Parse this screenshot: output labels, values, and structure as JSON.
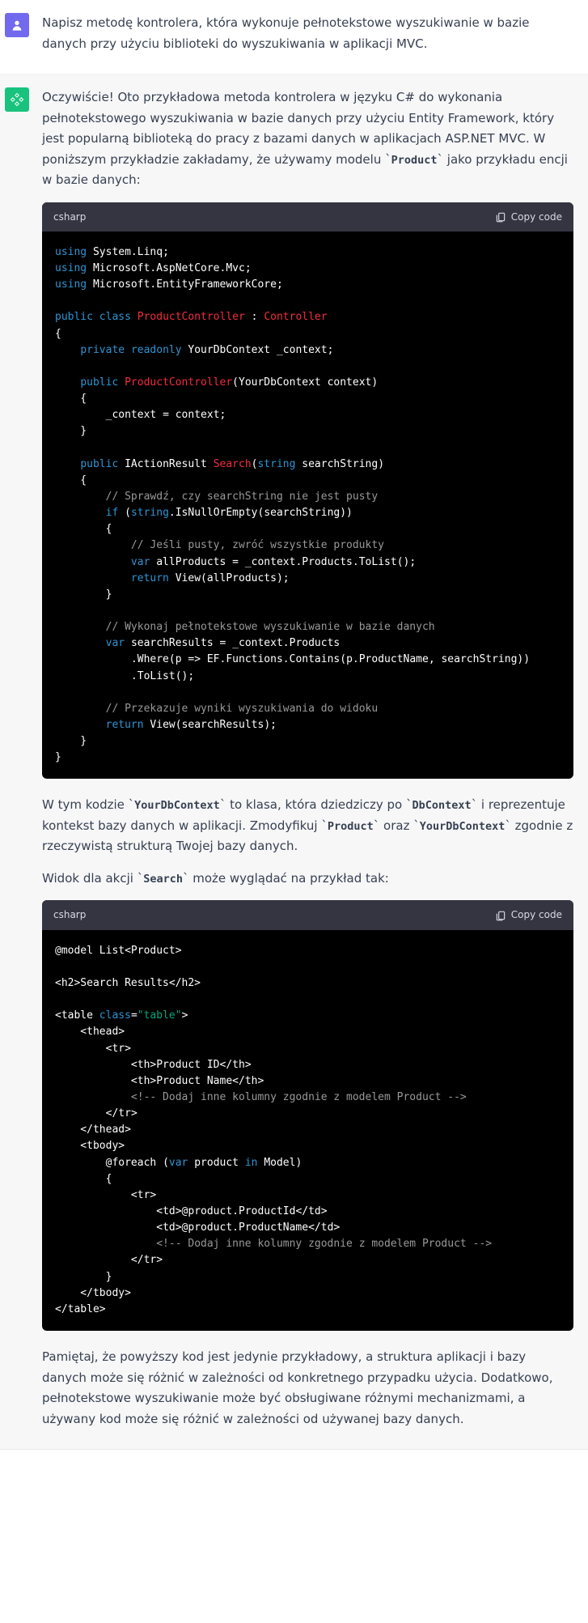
{
  "user": {
    "message": "Napisz metodę kontrolera, która wykonuje pełnotekstowe wyszukiwanie w bazie danych przy użyciu biblioteki do wyszukiwania w aplikacji MVC."
  },
  "assistant": {
    "intro_0": "Oczywiście! Oto przykładowa metoda kontrolera w języku C# do wykonania pełnotekstowego wyszukiwania w bazie danych przy użyciu Entity Framework, który jest popularną biblioteką do pracy z bazami danych w aplikacjach ASP.NET MVC. W poniższym przykładzie zakładamy, że używamy modelu ",
    "intro_code_product": "Product",
    "intro_1": " jako przykładu encji w bazie danych:",
    "code1": {
      "lang": "csharp",
      "copy": "Copy code",
      "tokens": {
        "using": "using",
        "ns1": "System.Linq",
        "ns2": "Microsoft.AspNetCore.Mvc",
        "ns3": "Microsoft.EntityFrameworkCore",
        "public": "public",
        "class": "class",
        "private": "private",
        "readonly": "readonly",
        "return": "return",
        "var": "var",
        "if": "if",
        "string": "string",
        "ProductController": "ProductController",
        "Controller": "Controller",
        "YourDbContext": "YourDbContext",
        "_context": "_context",
        "context": "context",
        "IActionResult": "IActionResult",
        "Search": "Search",
        "searchString": "searchString",
        "IsNullOrEmpty": "IsNullOrEmpty",
        "allProducts": "allProducts",
        "Products": "Products",
        "ToList": "ToList",
        "View": "View",
        "searchResults": "searchResults",
        "Where": "Where",
        "EF": "EF",
        "Functions": "Functions",
        "Contains": "Contains",
        "ProductName": "ProductName",
        "c_check": "// Sprawdź, czy searchString nie jest pusty",
        "c_empty": "// Jeśli pusty, zwróć wszystkie produkty",
        "c_full": "// Wykonaj pełnotekstowe wyszukiwanie w bazie danych",
        "c_pass": "// Przekazuje wyniki wyszukiwania do widoku"
      }
    },
    "mid_0": "W tym kodzie ",
    "mid_code_ctx": "YourDbContext",
    "mid_1": " to klasa, która dziedziczy po ",
    "mid_code_db": "DbContext",
    "mid_2": " i reprezentuje kontekst bazy danych w aplikacji. Zmodyfikuj ",
    "mid_code_prod": "Product",
    "mid_3": " oraz ",
    "mid_code_ctx2": "YourDbContext",
    "mid_4": " zgodnie z rzeczywistą strukturą Twojej bazy danych.",
    "view_0": "Widok dla akcji ",
    "view_code_search": "Search",
    "view_1": " może wyglądać na przykład tak:",
    "code2": {
      "lang": "csharp",
      "copy": "Copy code",
      "tokens": {
        "model_line": "@model List<Product>",
        "h2": "<h2>Search Results</h2>",
        "lt": "<",
        "gt": ">",
        "sl": "/",
        "table": "table",
        "thead": "thead",
        "tbody": "tbody",
        "tr": "tr",
        "th": "th",
        "td": "td",
        "class": "class",
        "eq": "=",
        "table_str": "\"table\"",
        "pid": "Product ID",
        "pname": "Product Name",
        "cmt_col": "<!-- Dodaj inne kolumny zgodnie z modelem Product -->",
        "foreach": "@foreach",
        "var": "var",
        "product": "product",
        "in": "in",
        "Model": "Model",
        "atpid": "@product.ProductId",
        "atpname": "@product.ProductName"
      }
    },
    "outro": "Pamiętaj, że powyższy kod jest jedynie przykładowy, a struktura aplikacji i bazy danych może się różnić w zależności od konkretnego przypadku użycia. Dodatkowo, pełnotekstowe wyszukiwanie może być obsługiwane różnymi mechanizmami, a używany kod może się różnić w zależności od używanej bazy danych."
  }
}
